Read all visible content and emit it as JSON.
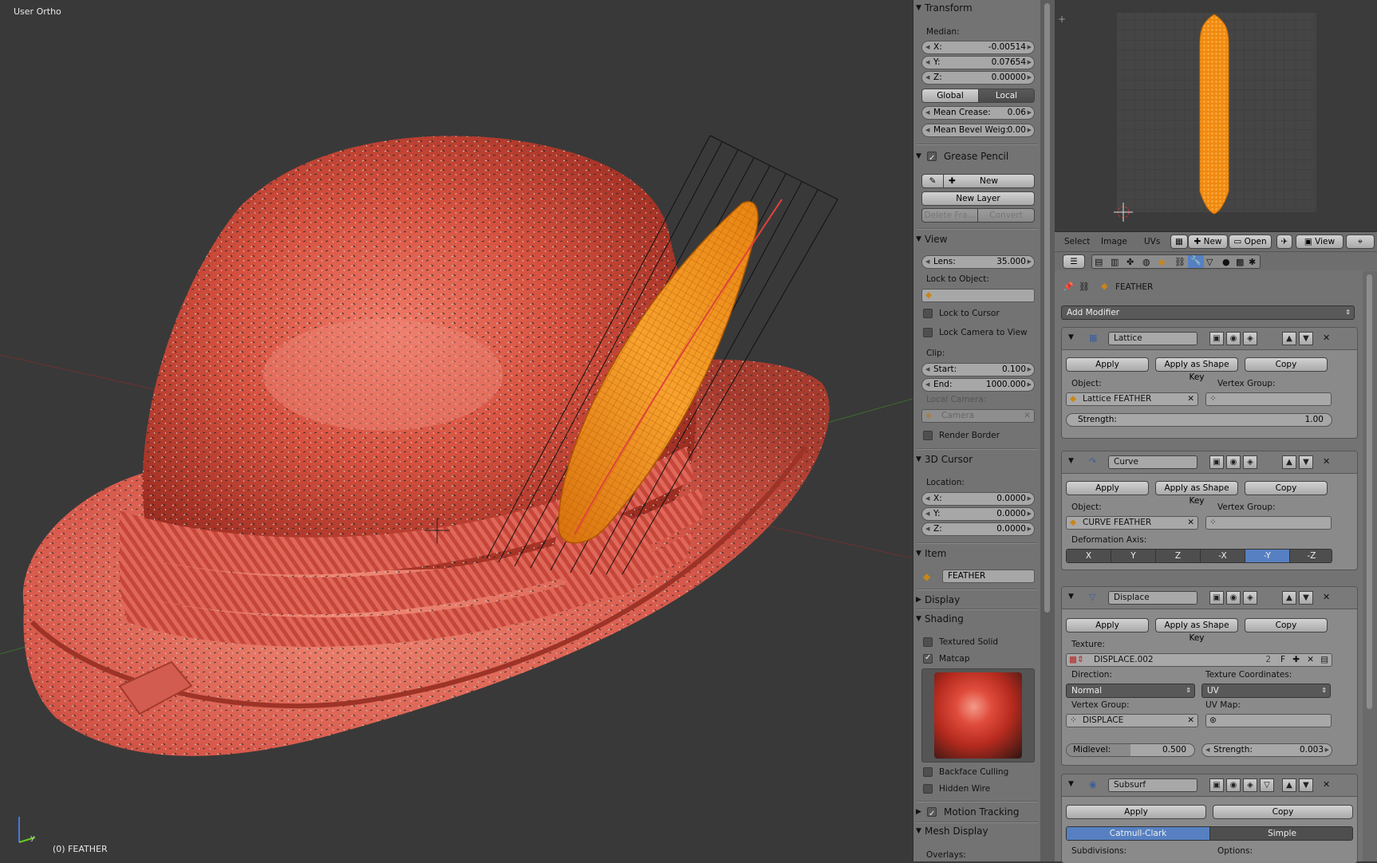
{
  "viewport": {
    "view_label": "User Ortho",
    "object_label": "(0) FEATHER"
  },
  "npanel": {
    "transform": {
      "header": "Transform",
      "median_label": "Median:",
      "x_label": "X:",
      "x_value": "-0.00514",
      "y_label": "Y:",
      "y_value": "0.07654",
      "z_label": "Z:",
      "z_value": "0.00000",
      "global_label": "Global",
      "local_label": "Local",
      "mean_crease_label": "Mean Crease:",
      "mean_crease_value": "0.06",
      "mean_bevel_label": "Mean Bevel Weig:",
      "mean_bevel_value": "0.00"
    },
    "grease_pencil": {
      "header": "Grease Pencil",
      "new_label": "New",
      "new_layer_label": "New Layer",
      "delete_frame_label": "Delete Fra...",
      "convert_label": "Convert"
    },
    "view": {
      "header": "View",
      "lens_label": "Lens:",
      "lens_value": "35.000",
      "lock_object_label": "Lock to Object:",
      "lock_cursor_label": "Lock to Cursor",
      "lock_camera_label": "Lock Camera to View",
      "clip_label": "Clip:",
      "start_label": "Start:",
      "start_value": "0.100",
      "end_label": "End:",
      "end_value": "1000.000",
      "local_camera_label": "Local Camera:",
      "camera_placeholder": "Camera",
      "render_border_label": "Render Border"
    },
    "cursor": {
      "header": "3D Cursor",
      "location_label": "Location:",
      "x_label": "X:",
      "x_value": "0.0000",
      "y_label": "Y:",
      "y_value": "0.0000",
      "z_label": "Z:",
      "z_value": "0.0000"
    },
    "item": {
      "header": "Item",
      "name_value": "FEATHER"
    },
    "display_header": "Display",
    "shading": {
      "header": "Shading",
      "textured_solid_label": "Textured Solid",
      "matcap_label": "Matcap",
      "backface_label": "Backface Culling",
      "hidden_wire_label": "Hidden Wire"
    },
    "motion_tracking_header": "Motion Tracking",
    "mesh_display": {
      "header": "Mesh Display",
      "overlays_label": "Overlays:"
    }
  },
  "uv_editor": {
    "menu_select": "Select",
    "menu_image": "Image",
    "menu_uvs": "UVs",
    "new_label": "New",
    "open_label": "Open",
    "view_label": "View"
  },
  "properties": {
    "object_name": "FEATHER",
    "add_modifier_label": "Add Modifier",
    "modifiers": {
      "lattice": {
        "name": "Lattice",
        "apply": "Apply",
        "apply_shape": "Apply as Shape Key",
        "copy": "Copy",
        "object_label": "Object:",
        "object_value": "Lattice FEATHER",
        "vertex_group_label": "Vertex Group:",
        "strength_label": "Strength:",
        "strength_value": "1.00"
      },
      "curve": {
        "name": "Curve",
        "apply": "Apply",
        "apply_shape": "Apply as Shape Key",
        "copy": "Copy",
        "object_label": "Object:",
        "object_value": "CURVE FEATHER",
        "vertex_group_label": "Vertex Group:",
        "deform_axis_label": "Deformation Axis:",
        "axes": [
          "X",
          "Y",
          "Z",
          "-X",
          "-Y",
          "-Z"
        ],
        "active_axis": "-Y"
      },
      "displace": {
        "name": "Displace",
        "apply": "Apply",
        "apply_shape": "Apply as Shape Key",
        "copy": "Copy",
        "texture_label": "Texture:",
        "texture_value": "DISPLACE.002",
        "texture_users": "2",
        "texture_fake": "F",
        "direction_label": "Direction:",
        "direction_value": "Normal",
        "tex_coords_label": "Texture Coordinates:",
        "tex_coords_value": "UV",
        "vertex_group_label": "Vertex Group:",
        "vertex_group_value": "DISPLACE",
        "uv_map_label": "UV Map:",
        "midlevel_label": "Midlevel:",
        "midlevel_value": "0.500",
        "strength_label": "Strength:",
        "strength_value": "0.003"
      },
      "subsurf": {
        "name": "Subsurf",
        "apply": "Apply",
        "copy": "Copy",
        "catmull_label": "Catmull-Clark",
        "simple_label": "Simple",
        "subdivisions_label": "Subdivisions:",
        "options_label": "Options:"
      }
    }
  },
  "colors": {
    "viewport_bg": "#393939",
    "panel_bg": "#737373",
    "hat_red": "#d9594a",
    "feather_orange": "#f0901c",
    "selection_blue": "#5680c2"
  }
}
